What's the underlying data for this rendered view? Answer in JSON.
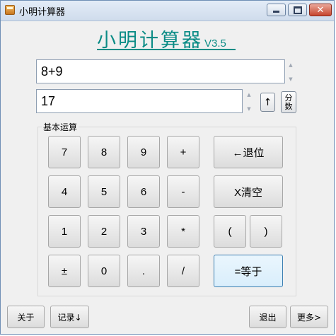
{
  "window": {
    "title": "小明计算器"
  },
  "brand": {
    "name": "小明计算器",
    "version": "V3.5"
  },
  "fields": {
    "expression": "8+9",
    "result": "17"
  },
  "side_buttons": {
    "up": "↑",
    "frac_top": "分",
    "frac_bottom": "数"
  },
  "group": {
    "label": "基本运算"
  },
  "keys": {
    "k7": "7",
    "k8": "8",
    "k9": "9",
    "plus": "+",
    "k4": "4",
    "k5": "5",
    "k6": "6",
    "minus": "-",
    "k1": "1",
    "k2": "2",
    "k3": "3",
    "mul": "*",
    "sign": "±",
    "k0": "0",
    "dot": ".",
    "div": "/",
    "backspace": "←退位",
    "clear": "X清空",
    "lparen": "(",
    "rparen": ")",
    "equals": "=等于"
  },
  "bottom": {
    "about": "关于",
    "record": "记录↓",
    "exit": "退出",
    "more": "更多>"
  },
  "colors": {
    "brand": "#0b8c86",
    "titlebar": "#dbe6f3"
  }
}
